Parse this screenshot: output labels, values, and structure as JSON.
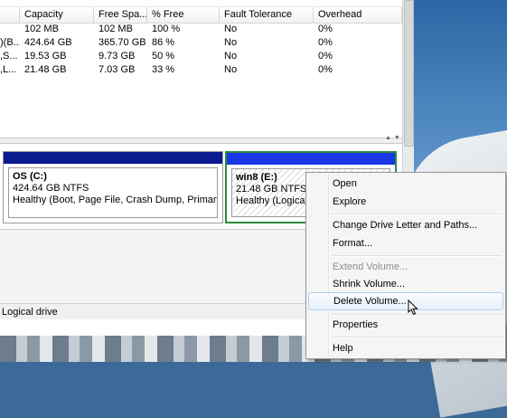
{
  "table": {
    "columns": [
      "Capacity",
      "Free Spa...",
      "% Free",
      "Fault Tolerance",
      "Overhead"
    ],
    "rows": [
      {
        "lead": "",
        "capacity": "102 MB",
        "free": "102 MB",
        "pct": "100 %",
        "fault": "No",
        "overhead": "0%"
      },
      {
        "lead": ")(B...",
        "capacity": "424.64 GB",
        "free": "365.70 GB",
        "pct": "86 %",
        "fault": "No",
        "overhead": "0%"
      },
      {
        "lead": ",S...",
        "capacity": "19.53 GB",
        "free": "9.73 GB",
        "pct": "50 %",
        "fault": "No",
        "overhead": "0%"
      },
      {
        "lead": ",L...",
        "capacity": "21.48 GB",
        "free": "7.03 GB",
        "pct": "33 %",
        "fault": "No",
        "overhead": "0%"
      }
    ]
  },
  "partitions": {
    "c": {
      "name": "OS  (C:)",
      "size": "424.64 GB NTFS",
      "status": "Healthy (Boot, Page File, Crash Dump, Primary Par"
    },
    "e": {
      "name": "win8  (E:)",
      "size": "21.48 GB NTFS",
      "status": "Healthy (Logical"
    }
  },
  "status_bar": {
    "text": "Logical drive"
  },
  "context_menu": {
    "items": [
      {
        "label": "Open",
        "state": "normal"
      },
      {
        "label": "Explore",
        "state": "normal"
      },
      {
        "label": "Change Drive Letter and Paths...",
        "state": "normal"
      },
      {
        "label": "Format...",
        "state": "normal"
      },
      {
        "label": "Extend Volume...",
        "state": "disabled"
      },
      {
        "label": "Shrink Volume...",
        "state": "normal"
      },
      {
        "label": "Delete Volume...",
        "state": "hover"
      },
      {
        "label": "Properties",
        "state": "normal"
      },
      {
        "label": "Help",
        "state": "normal"
      }
    ]
  },
  "colors": {
    "primary_bar": "#0a1a8f",
    "logical_bar": "#1b38e6",
    "selected_border": "#2f8a3d",
    "menu_hover": "#aecff7"
  },
  "icons": {
    "cursor": "arrow-cursor-icon"
  }
}
